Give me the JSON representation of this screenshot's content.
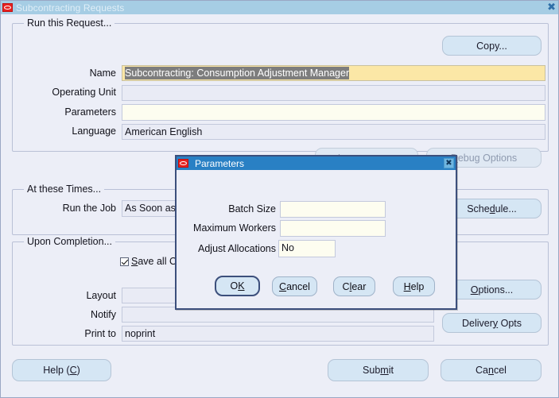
{
  "window": {
    "title": "Subcontracting Requests",
    "close_label": "✖",
    "logo_icon": "oracle-logo-icon"
  },
  "run_this_request": {
    "group_title": "Run this Request...",
    "copy_button": "Copy...",
    "fields": [
      {
        "label": "Name",
        "value": "Subcontracting: Consumption Adjustment Manager",
        "selected": true
      },
      {
        "label": "Operating Unit",
        "value": ""
      },
      {
        "label": "Parameters",
        "value": ""
      },
      {
        "label": "Language",
        "value": "American English"
      }
    ],
    "language_button": "Languages...",
    "debug_button_text": "ebug Options",
    "debug_button_mnemonic": "D"
  },
  "at_these_times": {
    "group_title": "At these Times...",
    "run_the_job_label": "Run the Job",
    "run_the_job_value": "As Soon as",
    "schedule_button": {
      "pre": "Sche",
      "u": "d",
      "post": "ule..."
    }
  },
  "upon_completion": {
    "group_title": "Upon Completion...",
    "save_checkbox": {
      "pre": "",
      "u": "S",
      "post": "ave all O",
      "checked": true
    },
    "fields": [
      {
        "label": "Layout",
        "value": ""
      },
      {
        "label": "Notify",
        "value": ""
      },
      {
        "label": "Print to",
        "value": "noprint"
      }
    ],
    "options_button": {
      "pre": "",
      "u": "O",
      "post": "ptions..."
    },
    "delivery_button": {
      "pre": "Deliver",
      "u": "y",
      "post": " Opts"
    }
  },
  "footer": {
    "help_button": {
      "pre": "Help (",
      "u": "C",
      "post": ")"
    },
    "submit_button": {
      "pre": "Sub",
      "u": "m",
      "post": "it"
    },
    "cancel_button": {
      "pre": "Ca",
      "u": "n",
      "post": "cel"
    }
  },
  "parameters_dialog": {
    "title": "Parameters",
    "close_label": "✖",
    "logo_icon": "oracle-logo-icon",
    "fields": [
      {
        "label": "Batch Size",
        "value": ""
      },
      {
        "label": "Maximum Workers",
        "value": ""
      },
      {
        "label": "Adjust Allocations",
        "value": "No"
      }
    ],
    "buttons": [
      {
        "pre": "O",
        "u": "K",
        "post": "",
        "default": true
      },
      {
        "pre": "",
        "u": "C",
        "post": "ancel",
        "default": false
      },
      {
        "pre": "C",
        "u": "l",
        "post": "ear",
        "default": false
      },
      {
        "pre": "",
        "u": "H",
        "post": "elp",
        "default": false
      }
    ]
  },
  "colors": {
    "window_bg": "#eceef7",
    "titlebar_inactive": "#a6cde4",
    "titlebar_active": "#2980c4",
    "button_face": "#d5e6f4",
    "field_readonly": "#e9ebf5",
    "field_editable": "#fdfdf0",
    "field_highlight": "#fbe7a6",
    "selection": "#7d7d7d",
    "oracle_red": "#e8201f"
  }
}
